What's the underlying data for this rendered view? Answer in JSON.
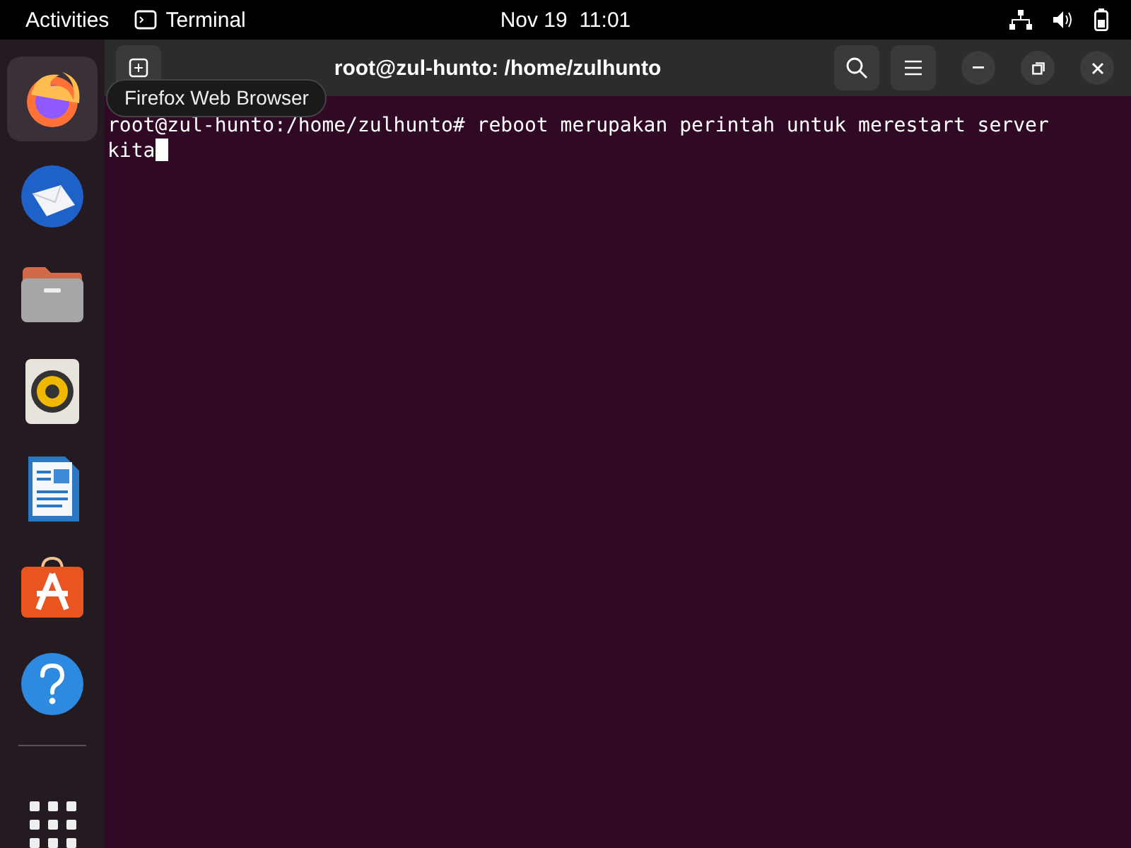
{
  "top_bar": {
    "activities": "Activities",
    "app_name": "Terminal",
    "clock": "Nov 19  11:01"
  },
  "dock": {
    "items": [
      {
        "kind": "firefox",
        "highlighted": true
      },
      {
        "kind": "mail",
        "highlighted": false
      },
      {
        "kind": "files",
        "highlighted": false
      },
      {
        "kind": "music",
        "highlighted": false
      },
      {
        "kind": "writer",
        "highlighted": false
      },
      {
        "kind": "store",
        "highlighted": false
      },
      {
        "kind": "help",
        "highlighted": false
      }
    ]
  },
  "tooltip": "Firefox Web Browser",
  "terminal": {
    "title": "root@zul-hunto: /home/zulhunto",
    "lines": [
      "root@zul-hunto:/home/zulhunto# reboot merupakan perintah untuk merestart server",
      "kita"
    ]
  }
}
